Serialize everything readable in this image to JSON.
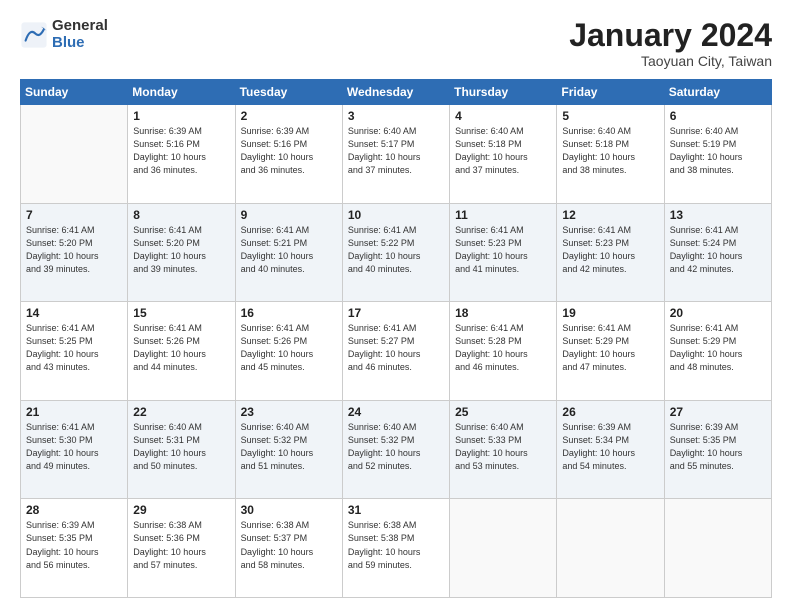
{
  "header": {
    "logo_general": "General",
    "logo_blue": "Blue",
    "title": "January 2024",
    "location": "Taoyuan City, Taiwan"
  },
  "days_of_week": [
    "Sunday",
    "Monday",
    "Tuesday",
    "Wednesday",
    "Thursday",
    "Friday",
    "Saturday"
  ],
  "weeks": [
    [
      {
        "day": "",
        "info": ""
      },
      {
        "day": "1",
        "info": "Sunrise: 6:39 AM\nSunset: 5:16 PM\nDaylight: 10 hours\nand 36 minutes."
      },
      {
        "day": "2",
        "info": "Sunrise: 6:39 AM\nSunset: 5:16 PM\nDaylight: 10 hours\nand 36 minutes."
      },
      {
        "day": "3",
        "info": "Sunrise: 6:40 AM\nSunset: 5:17 PM\nDaylight: 10 hours\nand 37 minutes."
      },
      {
        "day": "4",
        "info": "Sunrise: 6:40 AM\nSunset: 5:18 PM\nDaylight: 10 hours\nand 37 minutes."
      },
      {
        "day": "5",
        "info": "Sunrise: 6:40 AM\nSunset: 5:18 PM\nDaylight: 10 hours\nand 38 minutes."
      },
      {
        "day": "6",
        "info": "Sunrise: 6:40 AM\nSunset: 5:19 PM\nDaylight: 10 hours\nand 38 minutes."
      }
    ],
    [
      {
        "day": "7",
        "info": "Sunrise: 6:41 AM\nSunset: 5:20 PM\nDaylight: 10 hours\nand 39 minutes."
      },
      {
        "day": "8",
        "info": "Sunrise: 6:41 AM\nSunset: 5:20 PM\nDaylight: 10 hours\nand 39 minutes."
      },
      {
        "day": "9",
        "info": "Sunrise: 6:41 AM\nSunset: 5:21 PM\nDaylight: 10 hours\nand 40 minutes."
      },
      {
        "day": "10",
        "info": "Sunrise: 6:41 AM\nSunset: 5:22 PM\nDaylight: 10 hours\nand 40 minutes."
      },
      {
        "day": "11",
        "info": "Sunrise: 6:41 AM\nSunset: 5:23 PM\nDaylight: 10 hours\nand 41 minutes."
      },
      {
        "day": "12",
        "info": "Sunrise: 6:41 AM\nSunset: 5:23 PM\nDaylight: 10 hours\nand 42 minutes."
      },
      {
        "day": "13",
        "info": "Sunrise: 6:41 AM\nSunset: 5:24 PM\nDaylight: 10 hours\nand 42 minutes."
      }
    ],
    [
      {
        "day": "14",
        "info": "Sunrise: 6:41 AM\nSunset: 5:25 PM\nDaylight: 10 hours\nand 43 minutes."
      },
      {
        "day": "15",
        "info": "Sunrise: 6:41 AM\nSunset: 5:26 PM\nDaylight: 10 hours\nand 44 minutes."
      },
      {
        "day": "16",
        "info": "Sunrise: 6:41 AM\nSunset: 5:26 PM\nDaylight: 10 hours\nand 45 minutes."
      },
      {
        "day": "17",
        "info": "Sunrise: 6:41 AM\nSunset: 5:27 PM\nDaylight: 10 hours\nand 46 minutes."
      },
      {
        "day": "18",
        "info": "Sunrise: 6:41 AM\nSunset: 5:28 PM\nDaylight: 10 hours\nand 46 minutes."
      },
      {
        "day": "19",
        "info": "Sunrise: 6:41 AM\nSunset: 5:29 PM\nDaylight: 10 hours\nand 47 minutes."
      },
      {
        "day": "20",
        "info": "Sunrise: 6:41 AM\nSunset: 5:29 PM\nDaylight: 10 hours\nand 48 minutes."
      }
    ],
    [
      {
        "day": "21",
        "info": "Sunrise: 6:41 AM\nSunset: 5:30 PM\nDaylight: 10 hours\nand 49 minutes."
      },
      {
        "day": "22",
        "info": "Sunrise: 6:40 AM\nSunset: 5:31 PM\nDaylight: 10 hours\nand 50 minutes."
      },
      {
        "day": "23",
        "info": "Sunrise: 6:40 AM\nSunset: 5:32 PM\nDaylight: 10 hours\nand 51 minutes."
      },
      {
        "day": "24",
        "info": "Sunrise: 6:40 AM\nSunset: 5:32 PM\nDaylight: 10 hours\nand 52 minutes."
      },
      {
        "day": "25",
        "info": "Sunrise: 6:40 AM\nSunset: 5:33 PM\nDaylight: 10 hours\nand 53 minutes."
      },
      {
        "day": "26",
        "info": "Sunrise: 6:39 AM\nSunset: 5:34 PM\nDaylight: 10 hours\nand 54 minutes."
      },
      {
        "day": "27",
        "info": "Sunrise: 6:39 AM\nSunset: 5:35 PM\nDaylight: 10 hours\nand 55 minutes."
      }
    ],
    [
      {
        "day": "28",
        "info": "Sunrise: 6:39 AM\nSunset: 5:35 PM\nDaylight: 10 hours\nand 56 minutes."
      },
      {
        "day": "29",
        "info": "Sunrise: 6:38 AM\nSunset: 5:36 PM\nDaylight: 10 hours\nand 57 minutes."
      },
      {
        "day": "30",
        "info": "Sunrise: 6:38 AM\nSunset: 5:37 PM\nDaylight: 10 hours\nand 58 minutes."
      },
      {
        "day": "31",
        "info": "Sunrise: 6:38 AM\nSunset: 5:38 PM\nDaylight: 10 hours\nand 59 minutes."
      },
      {
        "day": "",
        "info": ""
      },
      {
        "day": "",
        "info": ""
      },
      {
        "day": "",
        "info": ""
      }
    ]
  ]
}
